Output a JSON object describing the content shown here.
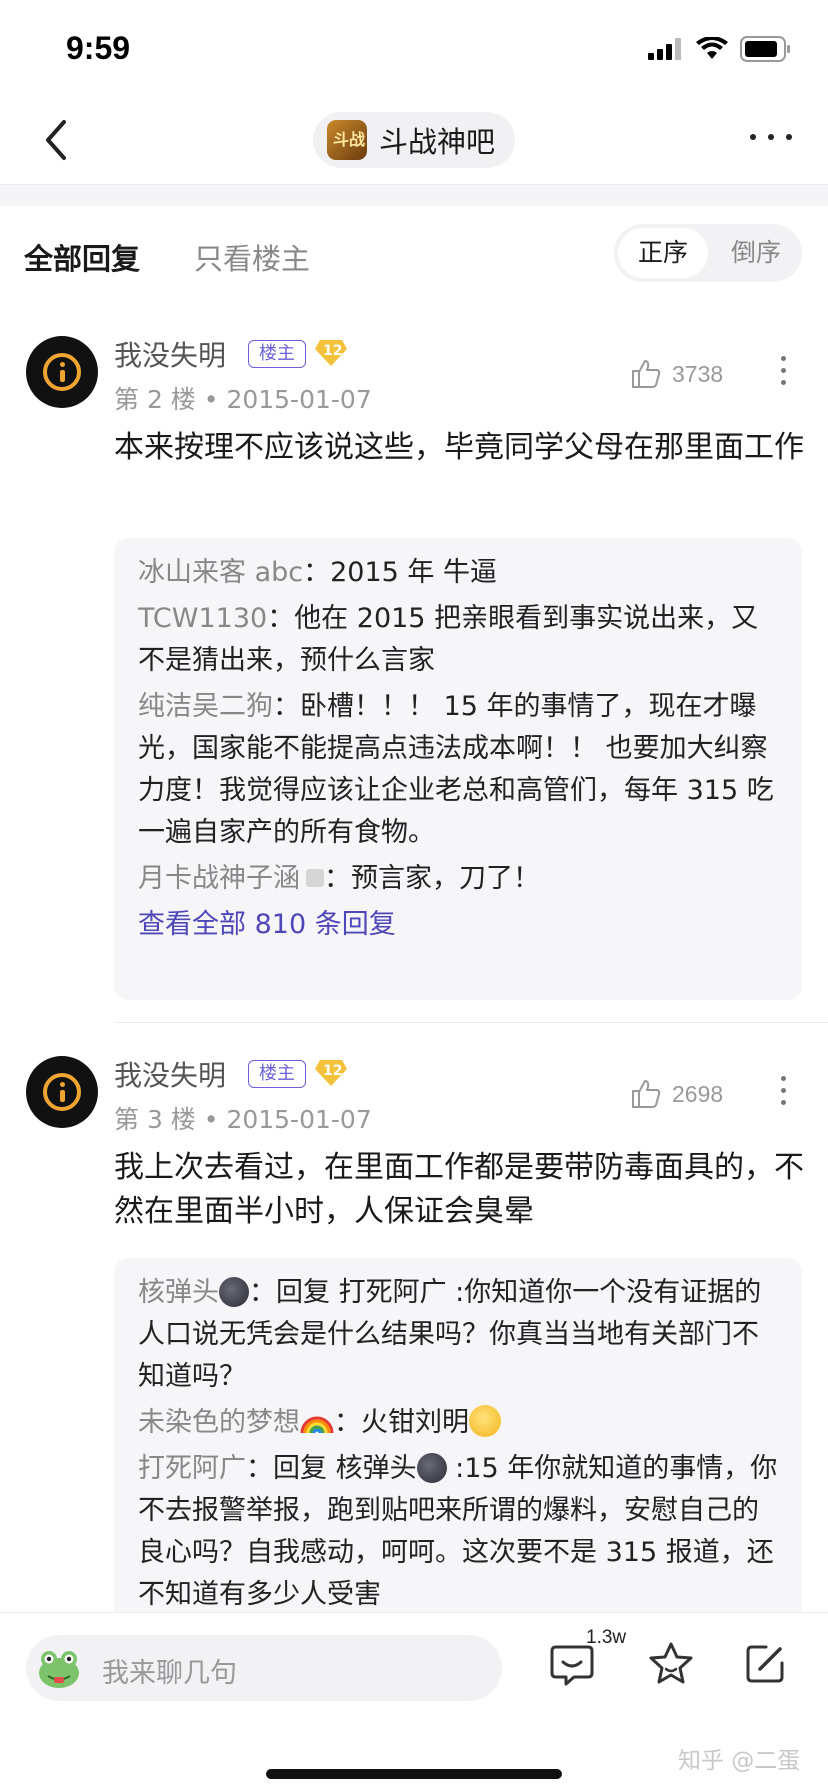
{
  "status_bar": {
    "time": "9:59"
  },
  "nav": {
    "forum_name": "斗战神吧",
    "forum_avatar_text": "斗战"
  },
  "tabs": {
    "all_replies": "全部回复",
    "owner_only": "只看楼主",
    "sort_asc": "正序",
    "sort_desc": "倒序"
  },
  "posts": [
    {
      "username": "我没失明",
      "owner_badge": "楼主",
      "level": "12",
      "floor_meta": "第 2 楼 • 2015-01-07",
      "likes": "3738",
      "body": "本来按理不应该说这些，毕竟同学父母在那里面工作",
      "replies": [
        {
          "name": "冰山来客 abc",
          "sep": "：",
          "text": "2015 年 牛逼"
        },
        {
          "name": "TCW1130",
          "sep": "：",
          "text": "他在 2015 把亲眼看到事实说出来，又不是猜出来，预什么言家"
        },
        {
          "name": "纯洁吴二狗",
          "sep": "：",
          "text": "卧槽！！！ 15 年的事情了，现在才曝光，国家能不能提高点违法成本啊！！ 也要加大纠察力度！我觉得应该让企业老总和高管们，每年 315 吃一遍自家产的所有食物。"
        },
        {
          "name": "月卡战神子涵",
          "sep": "：",
          "text": "预言家，刀了！"
        }
      ],
      "view_all": "查看全部 810 条回复"
    },
    {
      "username": "我没失明",
      "owner_badge": "楼主",
      "level": "12",
      "floor_meta": "第 3 楼 • 2015-01-07",
      "likes": "2698",
      "body": "我上次去看过，在里面工作都是要带防毒面具的，不然在里面半小时，人保证会臭晕",
      "replies": [
        {
          "name": "核弹头",
          "sep": "：",
          "text": "回复 打死阿广 :你知道你一个没有证据的人口说无凭会是什么结果吗？你真当当地有关部门不知道吗？"
        },
        {
          "name": "未染色的梦想",
          "sep": "：",
          "text": "火钳刘明"
        },
        {
          "name": "打死阿广",
          "sep": "：",
          "text_before": "回复 核弹头",
          "text_after": " :15 年你就知道的事情，你不去报警举报，跑到贴吧来所谓的爆料，安慰自己的良心吗？自我感动，呵呵。这次要不是 315 报道，还不知道有多少人受害"
        }
      ]
    }
  ],
  "bottom_bar": {
    "input_placeholder": "我来聊几句",
    "comment_count": "1.3w",
    "watermark": "知乎 @二蛋"
  },
  "icons": [
    "back-arrow-icon",
    "more-dots-icon",
    "like-icon",
    "comment-icon",
    "star-icon",
    "edit-icon",
    "frog-avatar-icon"
  ],
  "colors": {
    "accent": "#4e47b8",
    "owner_badge": "#6a62d9",
    "level_badge": "#f3c23a",
    "avatar_ring": "#f0a533"
  }
}
